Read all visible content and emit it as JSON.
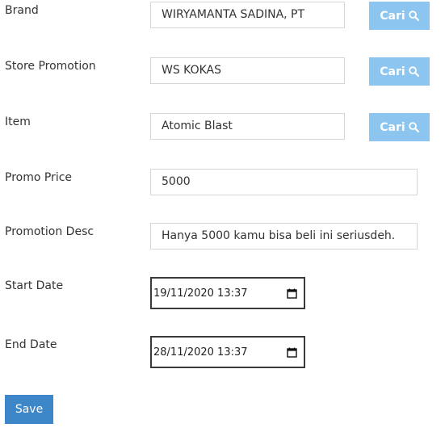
{
  "form": {
    "brand": {
      "label": "Brand",
      "value": "WIRYAMANTA SADINA, PT"
    },
    "store_promotion": {
      "label": "Store Promotion",
      "value": "WS KOKAS"
    },
    "item": {
      "label": "Item",
      "value": "Atomic Blast"
    },
    "promo_price": {
      "label": "Promo Price",
      "value": "5000"
    },
    "promotion_desc": {
      "label": "Promotion Desc",
      "value": "Hanya 5000 kamu bisa beli ini seriusdeh."
    },
    "start_date": {
      "label": "Start Date",
      "value": "19/11/2020 13:37"
    },
    "end_date": {
      "label": "End Date",
      "value": "28/11/2020 13:37"
    }
  },
  "buttons": {
    "cari_label": "Cari",
    "save_label": "Save"
  },
  "icons": {
    "search": "search-icon",
    "calendar": "calendar-icon"
  },
  "colors": {
    "cari_button_bg": "#8cc6f0",
    "save_button_bg": "#3d87c8",
    "input_border": "#d6d6d6",
    "date_border": "#3a3a3a"
  }
}
